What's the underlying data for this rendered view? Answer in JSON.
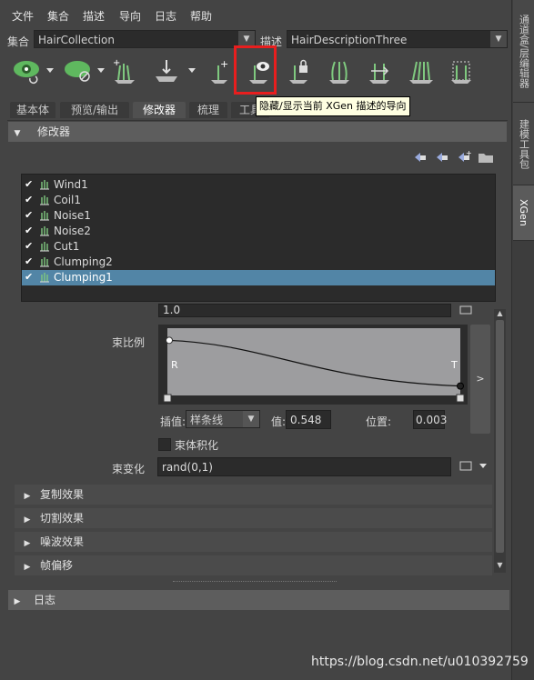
{
  "menu": [
    "文件",
    "集合",
    "描述",
    "导向",
    "日志",
    "帮助"
  ],
  "collection_label": "集合",
  "collection_value": "HairCollection",
  "description_label": "描述",
  "description_value": "HairDescriptionThree",
  "toolbar_icons": [
    "eye-visibility-icon",
    "leaf-visibility-icon",
    "add-guides-icon",
    "move-guides-icon",
    "add-guide-icon",
    "show-guides-icon",
    "lock-guides-icon",
    "sculpt-guides-icon",
    "flip-guides-icon",
    "rebuild-guides-icon",
    "guide-shape-icon"
  ],
  "tooltip": "隐藏/显示当前 XGen 描述的导向",
  "tabs": [
    "基本体",
    "预览/输出",
    "修改器",
    "梳理",
    "工具"
  ],
  "active_tab": "修改器",
  "section_modifiers": "修改器",
  "modifiers": [
    {
      "name": "Wind1",
      "checked": true,
      "selected": false,
      "icon": "wind-icon"
    },
    {
      "name": "Coil1",
      "checked": true,
      "selected": false,
      "icon": "coil-icon"
    },
    {
      "name": "Noise1",
      "checked": true,
      "selected": false,
      "icon": "noise-icon"
    },
    {
      "name": "Noise2",
      "checked": true,
      "selected": false,
      "icon": "noise-icon"
    },
    {
      "name": "Cut1",
      "checked": true,
      "selected": false,
      "icon": "cut-icon"
    },
    {
      "name": "Clumping2",
      "checked": true,
      "selected": false,
      "icon": "clumping-icon"
    },
    {
      "name": "Clumping1",
      "checked": true,
      "selected": true,
      "icon": "clumping-icon"
    }
  ],
  "partial_value": "1.0",
  "clump_scale_label": "束比例",
  "ramp_left_label": "R",
  "ramp_right_label": "T",
  "ramp_curve": {
    "start": 0.82,
    "end": 0.14
  },
  "interp_label": "插值:",
  "interp_value": "样条线",
  "value_label": "值:",
  "value_value": "0.548",
  "position_label": "位置:",
  "position_value": "0.003",
  "ramp_expand_label": ">",
  "clump_volume_label": "束体积化",
  "clump_var_label": "束变化",
  "clump_var_value": "rand(0,1)",
  "subsections": [
    "复制效果",
    "切割效果",
    "噪波效果",
    "帧偏移"
  ],
  "section_log": "日志",
  "side_tabs": [
    {
      "label": "通道盒/层编辑器",
      "active": false
    },
    {
      "label": "建模工具包",
      "active": false
    },
    {
      "label": "XGen",
      "active": true
    }
  ],
  "watermark": "https://blog.csdn.net/u010392759"
}
